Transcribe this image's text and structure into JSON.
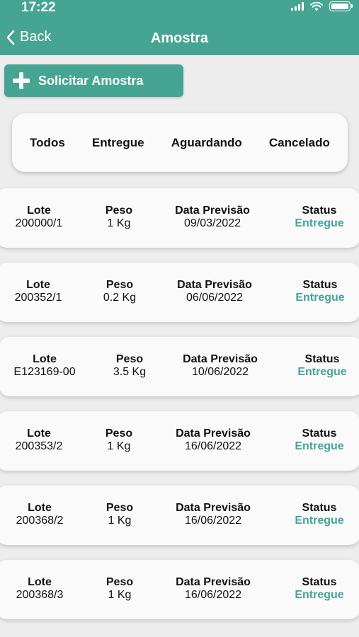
{
  "status_bar": {
    "time": "17:22"
  },
  "nav": {
    "back_label": "Back",
    "title": "Amostra"
  },
  "actions": {
    "request_label": "Solicitar Amostra"
  },
  "filters": [
    "Todos",
    "Entregue",
    "Aguardando",
    "Cancelado"
  ],
  "headers": {
    "lote": "Lote",
    "peso": "Peso",
    "data": "Data Previsão",
    "status": "Status"
  },
  "colors": {
    "accent": "#46a493",
    "background": "#ededed",
    "card": "#fafafa"
  },
  "samples": [
    {
      "lote": "200000/1",
      "peso": "1 Kg",
      "data": "09/03/2022",
      "status": "Entregue"
    },
    {
      "lote": "200352/1",
      "peso": "0.2 Kg",
      "data": "06/06/2022",
      "status": "Entregue"
    },
    {
      "lote": "E123169-00",
      "peso": "3.5 Kg",
      "data": "10/06/2022",
      "status": "Entregue"
    },
    {
      "lote": "200353/2",
      "peso": "1 Kg",
      "data": "16/06/2022",
      "status": "Entregue"
    },
    {
      "lote": "200368/2",
      "peso": "1 Kg",
      "data": "16/06/2022",
      "status": "Entregue"
    },
    {
      "lote": "200368/3",
      "peso": "1 Kg",
      "data": "16/06/2022",
      "status": "Entregue"
    }
  ]
}
